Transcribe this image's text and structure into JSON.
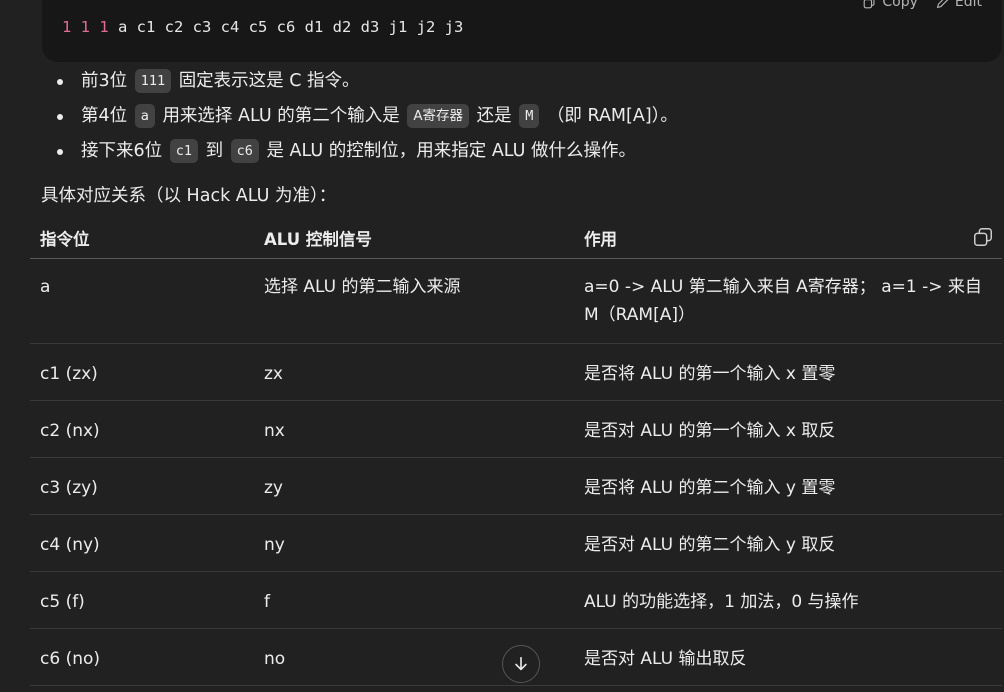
{
  "code": {
    "copy_label": "Copy",
    "edit_label": "Edit",
    "nums": "1 1 1",
    "rest": " a c1 c2 c3 c4 c5 c6 d1 d2 d3 j1 j2 j3"
  },
  "bullets": [
    {
      "pre": "前3位",
      "code": "111",
      "post": "固定表示这是 C 指令。"
    },
    {
      "pre": "第4位",
      "code": "a",
      "mid": "用来选择 ALU 的第二个输入是",
      "code2": "A寄存器",
      "mid2": "还是",
      "code3": "M",
      "post": "（即 RAM[A]）。"
    },
    {
      "pre": "接下来6位",
      "code": "c1",
      "mid": "到",
      "code2": "c6",
      "post": "是 ALU 的控制位，用来指定 ALU 做什么操作。"
    }
  ],
  "intro": "具体对应关系（以 Hack ALU 为准）：",
  "table": {
    "headers": [
      "指令位",
      "ALU 控制信号",
      "作用"
    ],
    "rows": [
      [
        "a",
        "选择 ALU 的第二输入来源",
        "a=0 -> ALU 第二输入来自 A寄存器； a=1 -> 来自 M（RAM[A]）"
      ],
      [
        "c1 (zx)",
        "zx",
        "是否将 ALU 的第一个输入 x 置零"
      ],
      [
        "c2 (nx)",
        "nx",
        "是否对 ALU 的第一个输入 x 取反"
      ],
      [
        "c3 (zy)",
        "zy",
        "是否将 ALU 的第二个输入 y 置零"
      ],
      [
        "c4 (ny)",
        "ny",
        "是否对 ALU 的第二个输入 y 取反"
      ],
      [
        "c5 (f)",
        "f",
        "ALU 的功能选择，1 加法，0 与操作"
      ],
      [
        "c6 (no)",
        "no",
        "是否对 ALU 输出取反"
      ]
    ]
  },
  "icons": {
    "copy_table": "copy-icon",
    "scroll_down": "arrow-down-icon",
    "code_copy": "copy-icon",
    "code_edit": "pencil-icon"
  }
}
